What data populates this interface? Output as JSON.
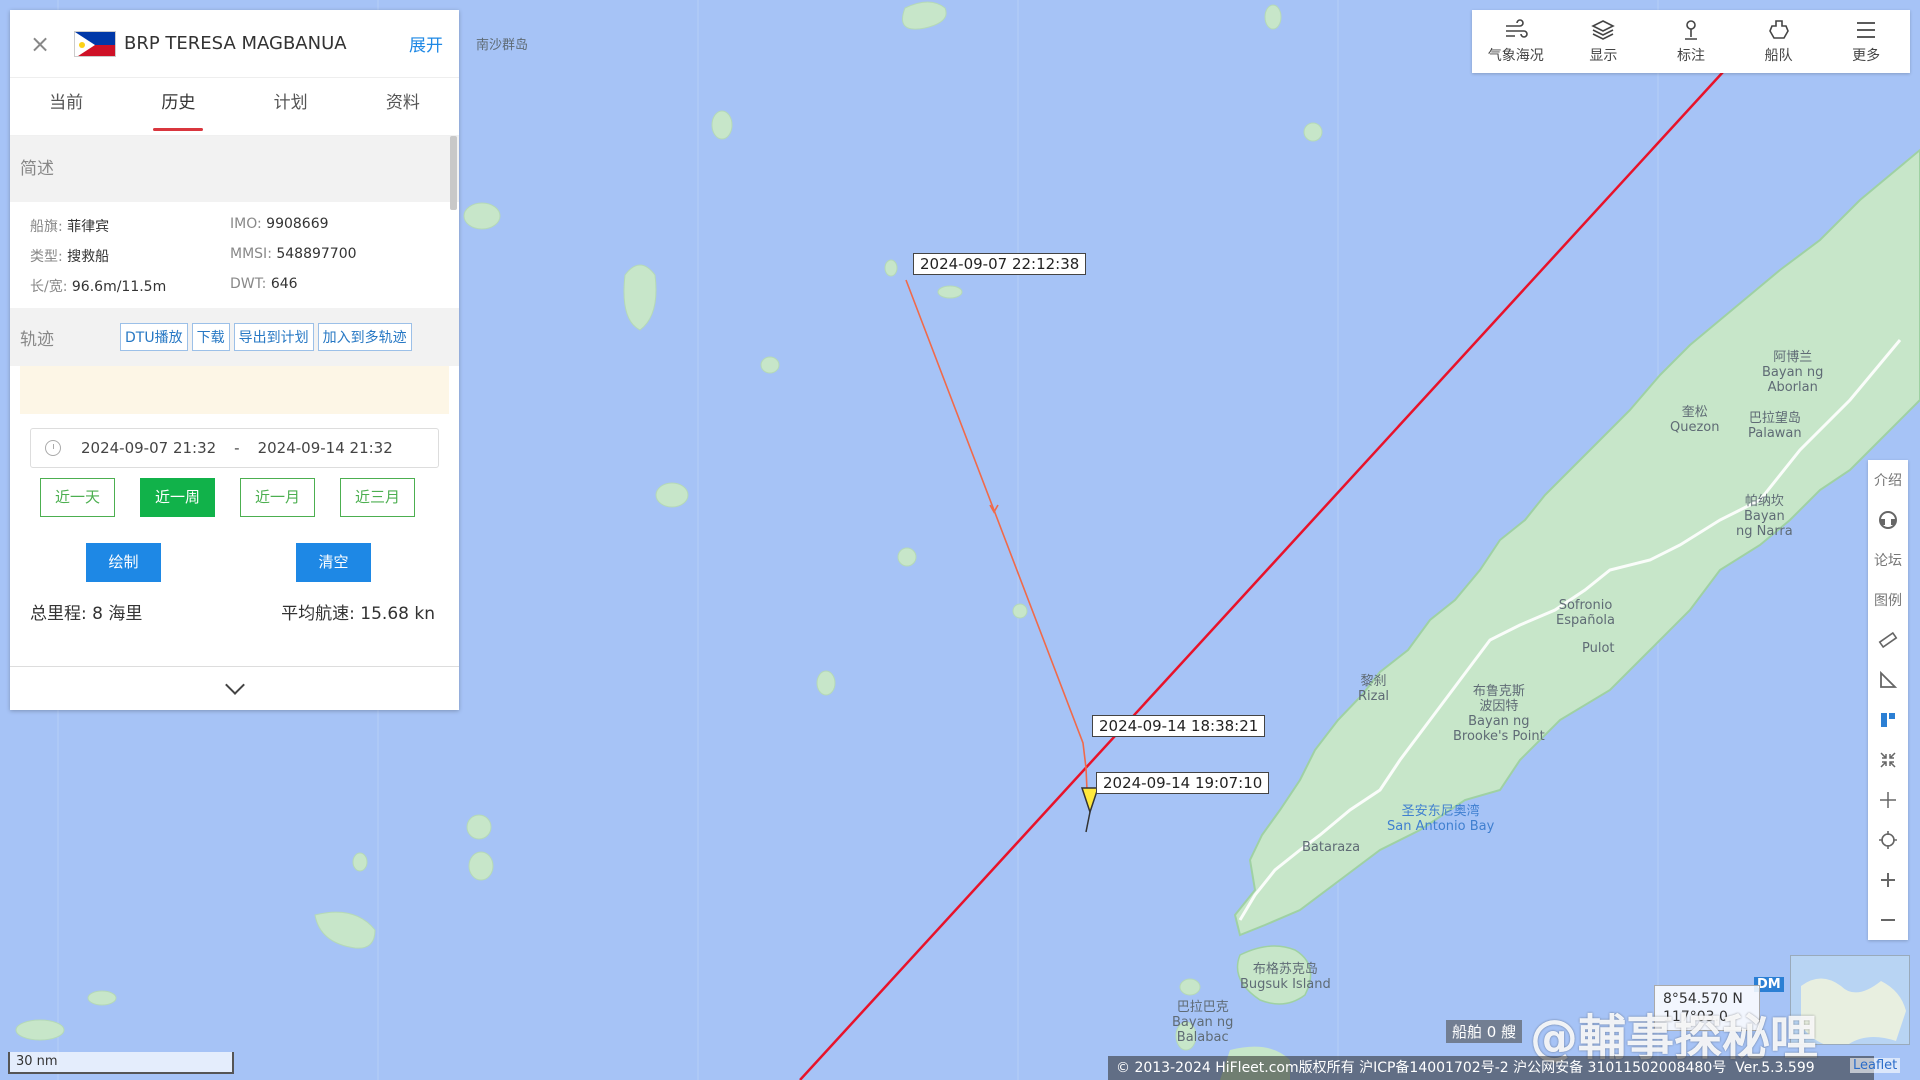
{
  "panel": {
    "vessel_name": "BRP TERESA MAGBANUA",
    "expand_label": "展开",
    "tabs": [
      "当前",
      "历史",
      "计划",
      "资料"
    ],
    "active_tab": "历史",
    "summary_title": "简述",
    "info": {
      "flag_label": "船旗",
      "flag_value": "菲律宾",
      "imo_label": "IMO",
      "imo_value": "9908669",
      "type_label": "类型",
      "type_value": "搜救船",
      "mmsi_label": "MMSI",
      "mmsi_value": "548897700",
      "size_label": "长/宽",
      "size_value": "96.6m/11.5m",
      "dwt_label": "DWT",
      "dwt_value": "646"
    },
    "track_title": "轨迹",
    "track_buttons": [
      "DTU播放",
      "下载",
      "导出到计划",
      "加入到多轨迹"
    ],
    "date_start": "2024-09-07 21:32",
    "date_sep": "-",
    "date_end": "2024-09-14 21:32",
    "quick_ranges": [
      "近一天",
      "近一周",
      "近一月",
      "近三月"
    ],
    "active_range": "近一周",
    "draw_label": "绘制",
    "clear_label": "清空",
    "total_distance": "总里程: 8 海里",
    "avg_speed": "平均航速: 15.68 kn"
  },
  "toolbar": [
    {
      "label": "气象海况",
      "icon": "wind-icon"
    },
    {
      "label": "显示",
      "icon": "layers-icon"
    },
    {
      "label": "标注",
      "icon": "pin-icon"
    },
    {
      "label": "船队",
      "icon": "fleet-icon"
    },
    {
      "label": "更多",
      "icon": "menu-icon"
    }
  ],
  "right_tools": {
    "intro": "介绍",
    "forum": "论坛",
    "legend": "图例"
  },
  "map": {
    "labels": {
      "nansha": "南沙群岛",
      "aborlan_cn": "阿博兰",
      "aborlan_en1": "Bayan ng",
      "aborlan_en2": "Aborlan",
      "quezon_cn": "奎松",
      "quezon_en": "Quezon",
      "palawan_cn": "巴拉望岛",
      "palawan_en": "Palawan",
      "narra_cn": "帕纳坎",
      "narra_en1": "Bayan",
      "narra_en2": "ng Narra",
      "sofronio_en1": "Sofronio",
      "sofronio_en2": "Española",
      "pulot": "Pulot",
      "rizal_cn": "黎刹",
      "rizal_en": "Rizal",
      "brooke_cn1": "布鲁克斯",
      "brooke_cn2": "波因特",
      "brooke_en1": "Bayan ng",
      "brooke_en2": "Brooke's Point",
      "sab_cn": "圣安东尼奥湾",
      "sab_en": "San Antonio Bay",
      "bataraza": "Bataraza",
      "bugsuk_cn": "布格苏克岛",
      "bugsuk_en": "Bugsuk Island",
      "balabac_cn": "巴拉巴克",
      "balabac_en1": "Bayan ng",
      "balabac_en2": "Balabac"
    },
    "track_points": [
      {
        "time": "2024-09-07 22:12:38"
      },
      {
        "time": "2024-09-14 18:38:21"
      },
      {
        "time": "2024-09-14 19:07:10"
      }
    ],
    "scale": "30 nm",
    "coordinate_lat": "8°54.570 N",
    "coordinate_lon": "117°03.0",
    "dm_label": "DM",
    "ship_count": "船舶 0 艘",
    "copyright": "© 2013-2024 HiFleet.com版权所有 沪ICP备14001702号-2 沪公网安备 31011502008480号",
    "version": "Ver.5.3.599",
    "leaflet": "Leaflet",
    "watermark": "@輔事探秘哩"
  },
  "colors": {
    "sea": "#a6c3f6",
    "land": "#c7e6c9",
    "route_line": "#e8132a",
    "track_line": "#f06a4a",
    "accent_blue": "#1e88e5",
    "accent_green": "#11b24a",
    "tab_underline": "#d9363e"
  }
}
